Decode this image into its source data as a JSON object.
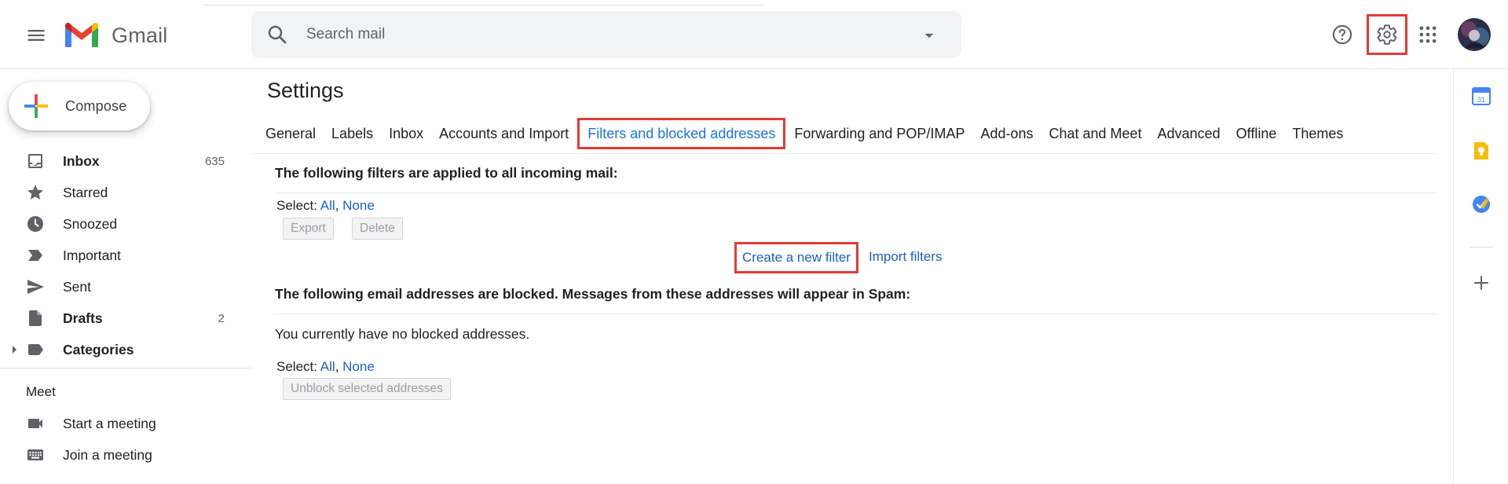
{
  "app": {
    "name": "Gmail"
  },
  "search": {
    "placeholder": "Search mail"
  },
  "compose": {
    "label": "Compose"
  },
  "nav": {
    "items": [
      {
        "label": "Inbox",
        "count": "635",
        "bold": true,
        "icon": "inbox-icon"
      },
      {
        "label": "Starred",
        "count": "",
        "bold": false,
        "icon": "star-icon"
      },
      {
        "label": "Snoozed",
        "count": "",
        "bold": false,
        "icon": "clock-icon"
      },
      {
        "label": "Important",
        "count": "",
        "bold": false,
        "icon": "important-icon"
      },
      {
        "label": "Sent",
        "count": "",
        "bold": false,
        "icon": "send-icon"
      },
      {
        "label": "Drafts",
        "count": "2",
        "bold": true,
        "icon": "draft-icon"
      },
      {
        "label": "Categories",
        "count": "",
        "bold": true,
        "icon": "label-icon"
      }
    ]
  },
  "meet": {
    "title": "Meet",
    "items": [
      {
        "label": "Start a meeting",
        "icon": "video-camera-icon"
      },
      {
        "label": "Join a meeting",
        "icon": "keyboard-icon"
      }
    ]
  },
  "settings": {
    "title": "Settings",
    "tabs": [
      {
        "label": "General"
      },
      {
        "label": "Labels"
      },
      {
        "label": "Inbox"
      },
      {
        "label": "Accounts and Import"
      },
      {
        "label": "Filters and blocked addresses",
        "active": true
      },
      {
        "label": "Forwarding and POP/IMAP"
      },
      {
        "label": "Add-ons"
      },
      {
        "label": "Chat and Meet"
      },
      {
        "label": "Advanced"
      },
      {
        "label": "Offline"
      },
      {
        "label": "Themes"
      }
    ],
    "filters": {
      "heading": "The following filters are applied to all incoming mail:",
      "select_label": "Select:",
      "select_all": "All",
      "select_sep": ",",
      "select_none": "None",
      "export_label": "Export",
      "delete_label": "Delete",
      "create_label": "Create a new filter",
      "import_label": "Import filters"
    },
    "blocked": {
      "heading": "The following email addresses are blocked. Messages from these addresses will appear in Spam:",
      "empty_text": "You currently have no blocked addresses.",
      "select_label": "Select:",
      "select_all": "All",
      "select_sep": ",",
      "select_none": "None",
      "unblock_label": "Unblock selected addresses"
    }
  },
  "colors": {
    "accent": "#1a73e8",
    "link": "#1a5fc8",
    "highlight": "#e53935"
  }
}
